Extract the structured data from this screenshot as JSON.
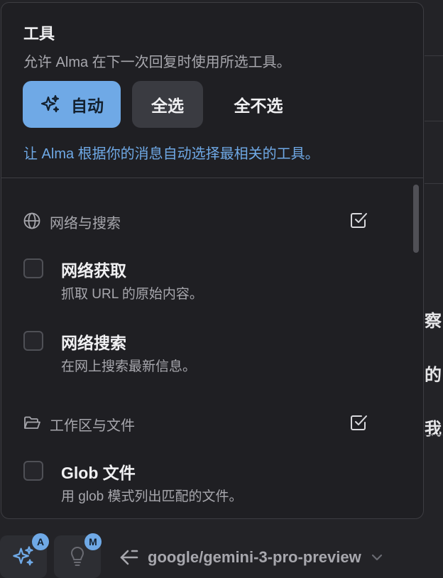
{
  "popover": {
    "title": "工具",
    "subtitle": "允许 Alma 在下一次回复时使用所选工具。",
    "buttons": {
      "auto": "自动",
      "select_all": "全选",
      "select_none": "全不选"
    },
    "hint": "让 Alma 根据你的消息自动选择最相关的工具。"
  },
  "sections": [
    {
      "label": "网络与搜索",
      "icon": "globe-icon",
      "items": [
        {
          "title": "网络获取",
          "desc": "抓取 URL 的原始内容。"
        },
        {
          "title": "网络搜索",
          "desc": "在网上搜索最新信息。"
        }
      ]
    },
    {
      "label": "工作区与文件",
      "icon": "folder-open-icon",
      "items": [
        {
          "title": "Glob 文件",
          "desc": "用 glob 模式列出匹配的文件。"
        }
      ]
    }
  ],
  "bottom_bar": {
    "auto_badge": "A",
    "think_badge": "M",
    "model": "google/gemini-3-pro-preview"
  },
  "background": {
    "fragments": [
      "察",
      "的",
      "我"
    ]
  },
  "colors": {
    "accent": "#6fa9e6",
    "panel": "#1f1f23",
    "page": "#232327"
  }
}
